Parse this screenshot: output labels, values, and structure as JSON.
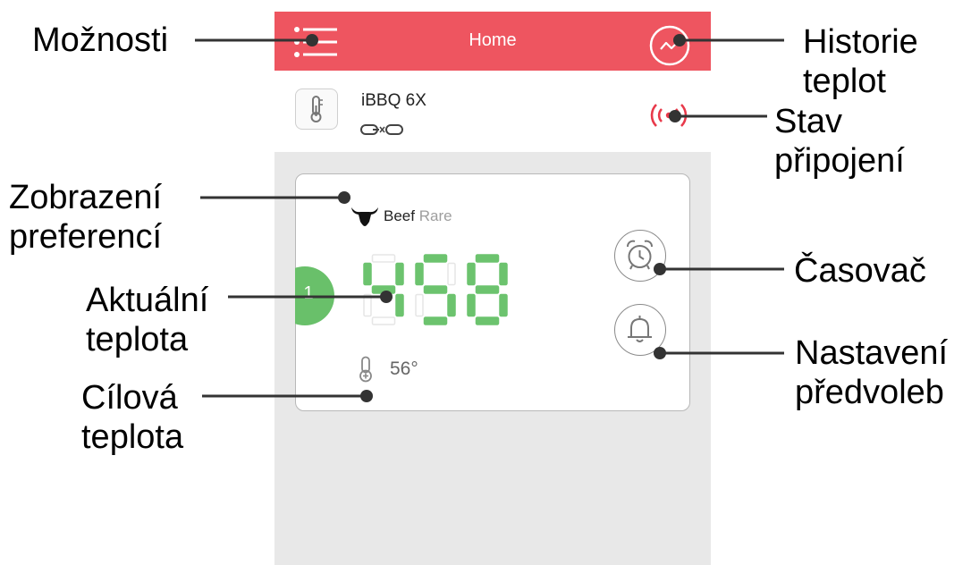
{
  "screen": {
    "title": "Home",
    "device_name": "iBBQ 6X",
    "probe": {
      "number": "1",
      "preference_food": "Beef",
      "preference_doneness": "Rare",
      "current_temperature": "458",
      "target_temperature": "56°"
    }
  },
  "callouts": {
    "options": "Možnosti",
    "history": "Historie\nteplot",
    "connection": "Stav\npřipojení",
    "preferences": "Zobrazení\npreferencí",
    "timer": "Časovač",
    "current_temp": "Aktuální\nteplota",
    "presets": "Nastavení\npředvoleb",
    "target_temp": "Cílová\nteplota"
  },
  "colors": {
    "header": "#ee5560",
    "probe_badge": "#69c06a",
    "digit_on": "#6cc36e",
    "digit_off": "#e6e6e6",
    "connection_signal": "#e8394a"
  },
  "icons": {
    "menu": "menu-icon",
    "history": "chart-circle-icon",
    "thermometer": "thermometer-icon",
    "link": "link-icon",
    "signal": "broadcast-signal-icon",
    "bull": "bull-head-icon",
    "target": "thermometer-plus-icon",
    "timer": "alarm-clock-icon",
    "presets": "bell-icon"
  }
}
